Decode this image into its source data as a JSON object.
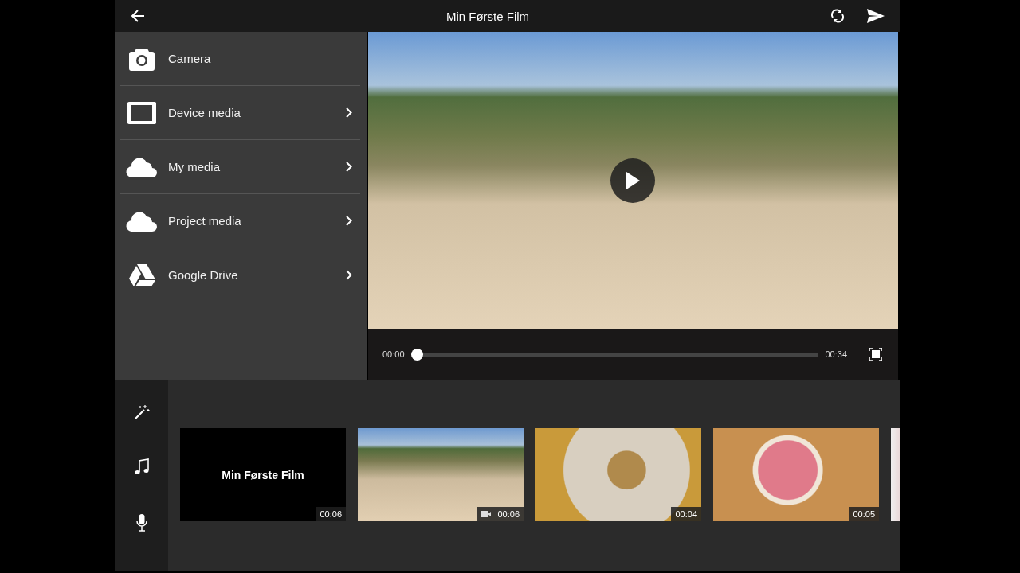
{
  "top_bar": {
    "title": "Min Første Film"
  },
  "sources": [
    {
      "label": "Camera",
      "has_arrow": false
    },
    {
      "label": "Device media",
      "has_arrow": true
    },
    {
      "label": "My media",
      "has_arrow": true
    },
    {
      "label": "Project media",
      "has_arrow": true
    },
    {
      "label": "Google Drive",
      "has_arrow": true
    }
  ],
  "player": {
    "elapsed": "00:00",
    "total": "00:34",
    "level": 0
  },
  "timeline": {
    "clips": [
      {
        "kind": "title",
        "title": "Min Første Film",
        "duration": "00:06"
      },
      {
        "kind": "video",
        "duration": "00:06"
      },
      {
        "kind": "photo",
        "duration": "00:04"
      },
      {
        "kind": "photo",
        "duration": "00:05"
      },
      {
        "kind": "photo"
      }
    ]
  }
}
